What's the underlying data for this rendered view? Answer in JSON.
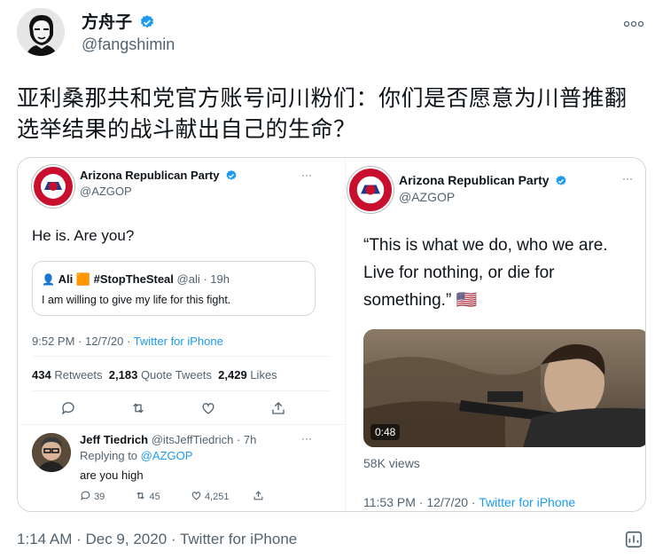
{
  "author": {
    "name": "方舟子",
    "handle": "@fangshimin"
  },
  "tweet": {
    "text": "亚利桑那共和党官方账号问川粉们：你们是否愿意为川普推翻选举结果的战斗献出自己的生命？",
    "timestamp": "1:14 AM · Dec 9, 2020 · Twitter for iPhone"
  },
  "left_card": {
    "name": "Arizona Republican Party",
    "handle": "@AZGOP",
    "text": "He is. Are you?",
    "quote": {
      "name": "Ali 🟧 #StopTheSteal",
      "handle": "@ali",
      "time": "· 19h",
      "text": "I am willing to give my life for this fight."
    },
    "meta_time": "9:52 PM · 12/7/20 · ",
    "meta_source": "Twitter for iPhone",
    "retweets_num": "434",
    "retweets_label": "Retweets",
    "quotes_num": "2,183",
    "quotes_label": "Quote Tweets",
    "likes_num": "2,429",
    "likes_label": "Likes",
    "reply": {
      "name": "Jeff Tiedrich",
      "handle": "@itsJeffTiedrich",
      "time": "· 7h",
      "replying_prefix": "Replying to ",
      "replying_to": "@AZGOP",
      "text": "are you high",
      "reply_count": "39",
      "retweet_count": "45",
      "like_count": "4,251"
    }
  },
  "right_card": {
    "name": "Arizona Republican Party",
    "handle": "@AZGOP",
    "text": "“This is what we do, who we are. Live for nothing, or die for something.” 🇺🇸",
    "video_duration": "0:48",
    "views": "58K views",
    "meta_time": "11:53 PM · 12/7/20 · ",
    "meta_source": "Twitter for iPhone"
  },
  "colors": {
    "accent": "#1d9bf0",
    "text": "#0f1419",
    "secondary": "#536471",
    "border": "#cfd9de"
  }
}
